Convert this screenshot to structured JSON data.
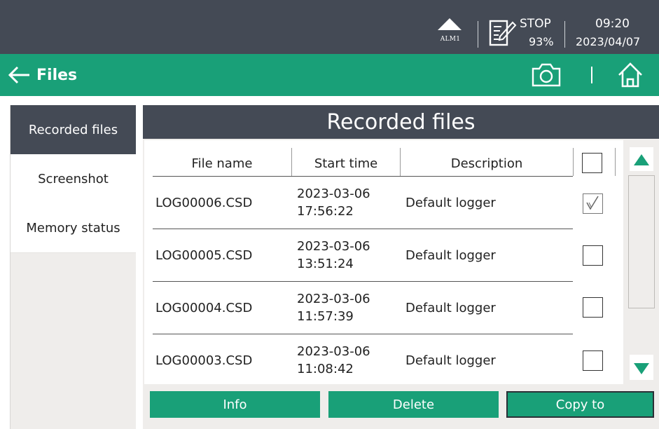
{
  "status_bar": {
    "alarm_label": "ALM1",
    "record_state": "STOP",
    "battery": "93%",
    "time": "09:20",
    "date": "2023/04/07"
  },
  "title_bar": {
    "title": "Files"
  },
  "sidebar": {
    "items": [
      {
        "label": "Recorded files",
        "active": true
      },
      {
        "label": "Screenshot",
        "active": false
      },
      {
        "label": "Memory status",
        "active": false
      }
    ]
  },
  "panel": {
    "title": "Recorded files",
    "columns": [
      "File name",
      "Start time",
      "Description"
    ],
    "rows": [
      {
        "file": "LOG00006.CSD",
        "date": "2023-03-06",
        "time": "17:56:22",
        "description": "Default logger",
        "checked": true
      },
      {
        "file": "LOG00005.CSD",
        "date": "2023-03-06",
        "time": "13:51:24",
        "description": "Default logger",
        "checked": false
      },
      {
        "file": "LOG00004.CSD",
        "date": "2023-03-06",
        "time": "11:57:39",
        "description": "Default logger",
        "checked": false
      },
      {
        "file": "LOG00003.CSD",
        "date": "2023-03-06",
        "time": "11:08:42",
        "description": "Default logger",
        "checked": false
      }
    ],
    "buttons": {
      "info": "Info",
      "delete": "Delete",
      "copy": "Copy to"
    }
  },
  "colors": {
    "accent_green": "#19a078",
    "header_dark": "#444a55",
    "panel_bg": "#efedeb"
  }
}
